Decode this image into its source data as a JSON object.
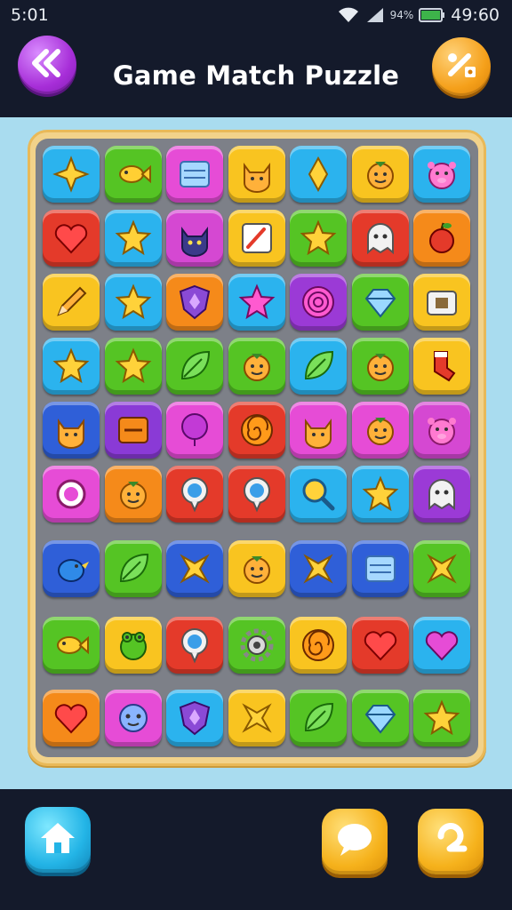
{
  "status_bar": {
    "time": "5:01",
    "battery_text": "94%",
    "clock_right": "49:60"
  },
  "header": {
    "title": "Game Match Puzzle",
    "back_icon": "double-chevron-left-icon",
    "tools_icon": "tools-icon"
  },
  "board": {
    "rows": [
      [
        {
          "color": "#2bb3ee",
          "icon": "sparkle"
        },
        {
          "color": "#55c424",
          "icon": "fish"
        },
        {
          "color": "#e64cd6",
          "icon": "box"
        },
        {
          "color": "#f9c420",
          "icon": "cat"
        },
        {
          "color": "#2bb3ee",
          "icon": "diamond"
        },
        {
          "color": "#f9c420",
          "icon": "face"
        },
        {
          "color": "#2bb3ee",
          "icon": "pig"
        }
      ],
      [
        {
          "color": "#e43a2a",
          "icon": "heart"
        },
        {
          "color": "#2bb3ee",
          "icon": "star"
        },
        {
          "color": "#d548d2",
          "icon": "cat-dark"
        },
        {
          "color": "#f9c420",
          "icon": "paint"
        },
        {
          "color": "#55c424",
          "icon": "star"
        },
        {
          "color": "#e43a2a",
          "icon": "ghost"
        },
        {
          "color": "#f58a1a",
          "icon": "apple"
        }
      ],
      [
        {
          "color": "#f9c420",
          "icon": "pencil"
        },
        {
          "color": "#2bb3ee",
          "icon": "star"
        },
        {
          "color": "#f58a1a",
          "icon": "shield"
        },
        {
          "color": "#2bb3ee",
          "icon": "star-pink"
        },
        {
          "color": "#9b3ad6",
          "icon": "swirl"
        },
        {
          "color": "#55c424",
          "icon": "gem"
        },
        {
          "color": "#f9c420",
          "icon": "camera"
        }
      ],
      [
        {
          "color": "#2bb3ee",
          "icon": "star"
        },
        {
          "color": "#55c424",
          "icon": "star"
        },
        {
          "color": "#55c424",
          "icon": "leaf"
        },
        {
          "color": "#55c424",
          "icon": "face"
        },
        {
          "color": "#2bb3ee",
          "icon": "leaf"
        },
        {
          "color": "#55c424",
          "icon": "face"
        },
        {
          "color": "#f9c420",
          "icon": "sock"
        }
      ],
      [
        {
          "color": "#2f5fd8",
          "icon": "cat"
        },
        {
          "color": "#8a3ad6",
          "icon": "box-orange"
        },
        {
          "color": "#e64cd6",
          "icon": "balloon"
        },
        {
          "color": "#e43a2a",
          "icon": "spiral"
        },
        {
          "color": "#e64cd6",
          "icon": "cat"
        },
        {
          "color": "#e64cd6",
          "icon": "face"
        },
        {
          "color": "#d548d2",
          "icon": "pig"
        }
      ],
      [
        {
          "color": "#e64cd6",
          "icon": "ring"
        },
        {
          "color": "#f58a1a",
          "icon": "face"
        },
        {
          "color": "#e43a2a",
          "icon": "pin"
        },
        {
          "color": "#e43a2a",
          "icon": "pin"
        },
        {
          "color": "#2bb3ee",
          "icon": "magnifier"
        },
        {
          "color": "#2bb3ee",
          "icon": "star"
        },
        {
          "color": "#9b3ad6",
          "icon": "ghost"
        }
      ],
      [
        {
          "color": "#2f5fd8",
          "icon": "bird"
        },
        {
          "color": "#55c424",
          "icon": "leaf"
        },
        {
          "color": "#2f5fd8",
          "icon": "x"
        },
        {
          "color": "#f9c420",
          "icon": "face"
        },
        {
          "color": "#2f5fd8",
          "icon": "x"
        },
        {
          "color": "#2f5fd8",
          "icon": "box"
        },
        {
          "color": "#55c424",
          "icon": "x"
        }
      ],
      [
        {
          "color": "#55c424",
          "icon": "fish"
        },
        {
          "color": "#f9c420",
          "icon": "frog"
        },
        {
          "color": "#e43a2a",
          "icon": "pin"
        },
        {
          "color": "#55c424",
          "icon": "gear"
        },
        {
          "color": "#f9c420",
          "icon": "spiral"
        },
        {
          "color": "#e43a2a",
          "icon": "heart"
        },
        {
          "color": "#2bb3ee",
          "icon": "heart-pink"
        }
      ],
      [
        {
          "color": "#f58a1a",
          "icon": "heart"
        },
        {
          "color": "#e64cd6",
          "icon": "fluff"
        },
        {
          "color": "#2bb3ee",
          "icon": "shield"
        },
        {
          "color": "#f9c420",
          "icon": "x"
        },
        {
          "color": "#55c424",
          "icon": "leaf"
        },
        {
          "color": "#55c424",
          "icon": "gem"
        },
        {
          "color": "#55c424",
          "icon": "star"
        }
      ]
    ]
  },
  "footer": {
    "home_icon": "home-icon",
    "chat_icon": "chat-bubble-icon",
    "hint_icon": "hint-icon"
  }
}
